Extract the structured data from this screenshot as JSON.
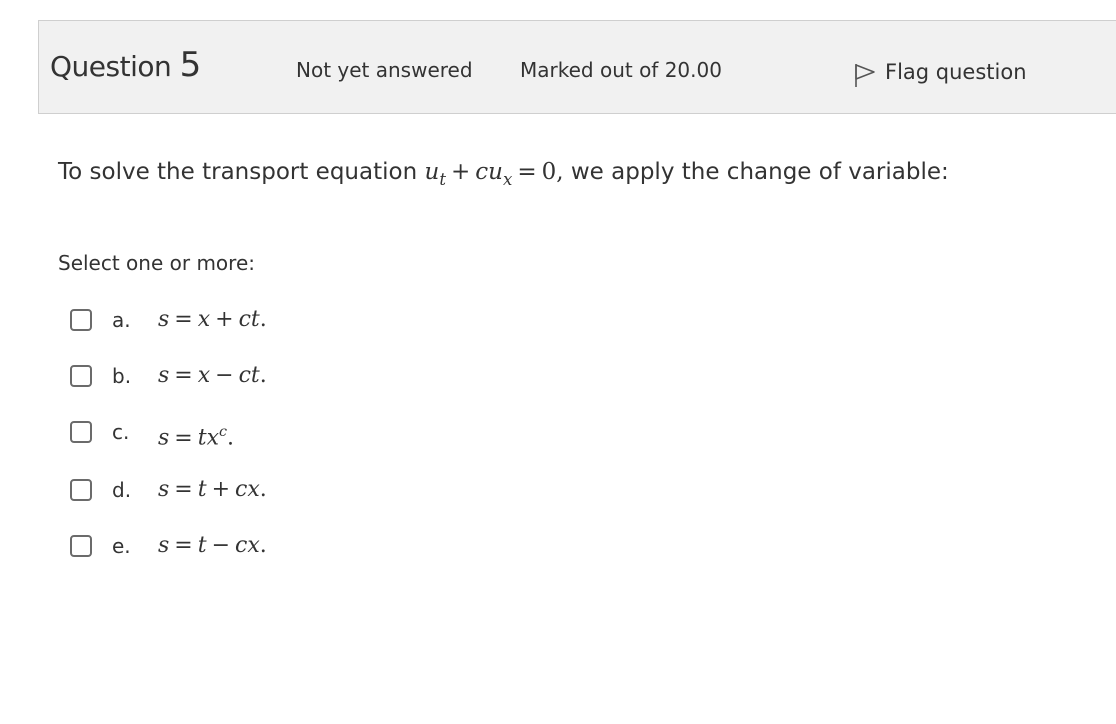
{
  "info": {
    "question_word": "Question",
    "question_number": "5",
    "state": "Not yet answered",
    "grade": "Marked out of 20.00",
    "flag_label": "Flag question",
    "flag_icon": "flag-icon"
  },
  "question": {
    "intro": "To solve the transport equation",
    "eq_u": "u",
    "eq_t": "t",
    "eq_plus": "+",
    "eq_c": "c",
    "eq_u2": "u",
    "eq_x": "x",
    "eq_equals": "=",
    "eq_zero": "0,",
    "outro": "we apply the change of variable:"
  },
  "prompt": "Select one or more:",
  "answers": [
    {
      "letter": "a.",
      "s": "s",
      "eq": "=",
      "p1": "x",
      "op": "+",
      "p2": "ct",
      "dot": "."
    },
    {
      "letter": "b.",
      "s": "s",
      "eq": "=",
      "p1": "x",
      "op": "−",
      "p2": "ct",
      "dot": "."
    },
    {
      "letter": "c.",
      "s": "s",
      "eq": "=",
      "p1": "tx",
      "sup": "c",
      "dot": "."
    },
    {
      "letter": "d.",
      "s": "s",
      "eq": "=",
      "p1": "t",
      "op": "+",
      "p2": "cx",
      "dot": "."
    },
    {
      "letter": "e.",
      "s": "s",
      "eq": "=",
      "p1": "t",
      "op": "−",
      "p2": "cx",
      "dot": "."
    }
  ]
}
